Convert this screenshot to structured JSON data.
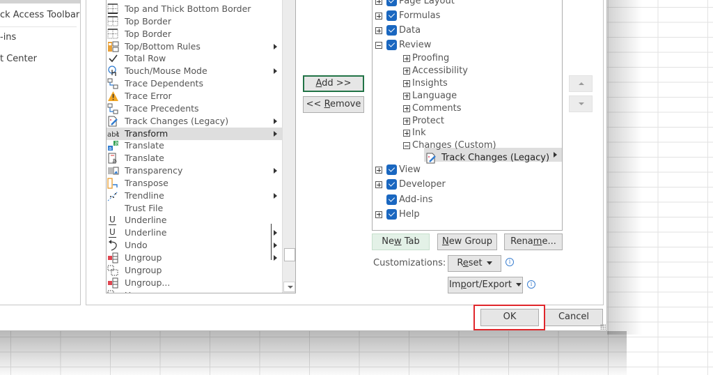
{
  "nav": {
    "items": [
      {
        "label": "ck Access Toolbar"
      },
      {
        "label": "-ins"
      },
      {
        "label": "t Center"
      }
    ]
  },
  "commands": {
    "items": [
      {
        "label": "Top and Thick Bottom Border",
        "icon": "thick-bottom-border-icon",
        "submenu": false
      },
      {
        "label": "Top Border",
        "icon": "top-border-icon",
        "submenu": false
      },
      {
        "label": "Top Border",
        "icon": "top-border-icon",
        "submenu": false
      },
      {
        "label": "Top/Bottom Rules",
        "icon": "top-bottom-rules-icon",
        "submenu": true
      },
      {
        "label": "Total Row",
        "icon": "checkmark-icon",
        "submenu": false
      },
      {
        "label": "Touch/Mouse Mode",
        "icon": "touch-mouse-icon",
        "submenu": true
      },
      {
        "label": "Trace Dependents",
        "icon": "trace-dependents-icon",
        "submenu": false
      },
      {
        "label": "Trace Error",
        "icon": "warning-icon",
        "submenu": false
      },
      {
        "label": "Trace Precedents",
        "icon": "trace-precedents-icon",
        "submenu": false
      },
      {
        "label": "Track Changes (Legacy)",
        "icon": "track-changes-icon",
        "submenu": true
      },
      {
        "label": "Transform",
        "icon": "transform-icon",
        "submenu": true,
        "selected": true
      },
      {
        "label": "Translate",
        "icon": "translate-icon",
        "submenu": false
      },
      {
        "label": "Translate",
        "icon": "translate-doc-icon",
        "submenu": false
      },
      {
        "label": "Transparency",
        "icon": "transparency-icon",
        "submenu": true
      },
      {
        "label": "Transpose",
        "icon": "transpose-icon",
        "submenu": false
      },
      {
        "label": "Trendline",
        "icon": "trendline-icon",
        "submenu": true
      },
      {
        "label": "Trust File",
        "icon": "",
        "submenu": false
      },
      {
        "label": "Underline",
        "icon": "underline-icon",
        "submenu": false
      },
      {
        "label": "Underline",
        "icon": "underline-icon",
        "submenu": true
      },
      {
        "label": "Undo",
        "icon": "undo-icon",
        "submenu": true
      },
      {
        "label": "Ungroup",
        "icon": "ungroup-icon",
        "submenu": true
      },
      {
        "label": "Ungroup",
        "icon": "ungroup-shapes-icon",
        "submenu": false
      },
      {
        "label": "Ungroup...",
        "icon": "ungroup-icon",
        "submenu": false
      },
      {
        "label": "Ungroup",
        "icon": "ungroup-shapes-icon",
        "submenu": false
      }
    ]
  },
  "buttons": {
    "add": {
      "pre": "",
      "u": "A",
      "post": "dd >>"
    },
    "remove": {
      "pre": "<< ",
      "u": "R",
      "post": "emove"
    },
    "new_tab": {
      "pre": "Ne",
      "u": "w",
      "post": " Tab"
    },
    "new_group": {
      "pre": "",
      "u": "N",
      "post": "ew Group"
    },
    "rename": {
      "pre": "Rena",
      "u": "m",
      "post": "e..."
    },
    "reset": {
      "pre": "R",
      "u": "e",
      "post": "set"
    },
    "import_export": {
      "pre": "Im",
      "u": "p",
      "post": "ort/Export"
    },
    "ok": "OK",
    "cancel": "Cancel"
  },
  "customizations_label": "Customizations:",
  "tree": {
    "items": [
      {
        "label": "Page Layout",
        "level": 0,
        "expander": "plus",
        "checked": true
      },
      {
        "label": "Formulas",
        "level": 0,
        "expander": "plus",
        "checked": true
      },
      {
        "label": "Data",
        "level": 0,
        "expander": "plus",
        "checked": true
      },
      {
        "label": "Review",
        "level": 0,
        "expander": "minus",
        "checked": true
      },
      {
        "label": "Proofing",
        "level": 1,
        "expander": "plus"
      },
      {
        "label": "Accessibility",
        "level": 1,
        "expander": "plus"
      },
      {
        "label": "Insights",
        "level": 1,
        "expander": "plus"
      },
      {
        "label": "Language",
        "level": 1,
        "expander": "plus"
      },
      {
        "label": "Comments",
        "level": 1,
        "expander": "plus"
      },
      {
        "label": "Protect",
        "level": 1,
        "expander": "plus"
      },
      {
        "label": "Ink",
        "level": 1,
        "expander": "plus"
      },
      {
        "label": "Changes (Custom)",
        "level": 1,
        "expander": "minus"
      },
      {
        "label": "Track Changes (Legacy)",
        "level": 2,
        "selected": true,
        "submenu": true
      },
      {
        "label": "View",
        "level": 0,
        "expander": "plus",
        "checked": true
      },
      {
        "label": "Developer",
        "level": 0,
        "expander": "plus",
        "checked": true
      },
      {
        "label": "Add-ins",
        "level": 0,
        "expander": "none",
        "checked": true
      },
      {
        "label": "Help",
        "level": 0,
        "expander": "plus",
        "checked": true
      }
    ]
  },
  "colors": {
    "accent_green": "#217346",
    "checkbox_blue": "#1a67c0",
    "highlight_red": "#e0262b"
  }
}
